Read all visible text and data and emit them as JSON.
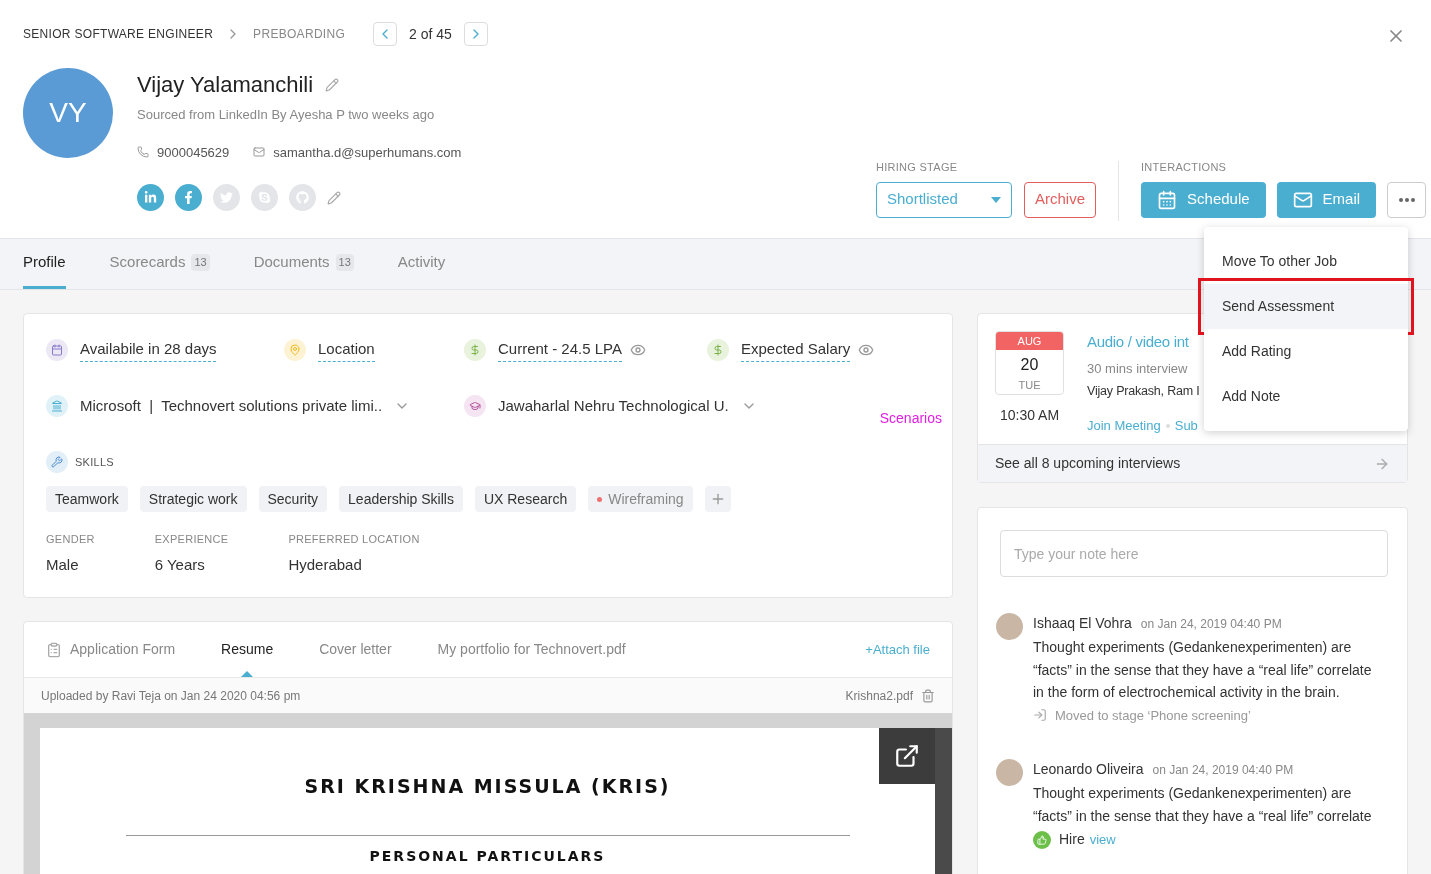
{
  "breadcrumb": {
    "job": "SENIOR SOFTWARE ENGINEER",
    "stage": "PREBOARDING",
    "position": "2 of 45"
  },
  "candidate": {
    "initials": "VY",
    "name": "Vijay Yalamanchili",
    "source": "Sourced from LinkedIn By Ayesha P two weeks ago",
    "phone": "9000045629",
    "email": "samantha.d@superhumans.com",
    "social": [
      {
        "kind": "linkedin",
        "on": true
      },
      {
        "kind": "facebook",
        "on": true
      },
      {
        "kind": "twitter",
        "on": false
      },
      {
        "kind": "skype",
        "on": false
      },
      {
        "kind": "github",
        "on": false
      }
    ]
  },
  "hiring_stage": {
    "label": "HIRING STAGE",
    "value": "Shortlisted",
    "archive": "Archive"
  },
  "interactions": {
    "label": "INTERACTIONS",
    "buttons": [
      {
        "kind": "calendar",
        "label": "Schedule"
      },
      {
        "kind": "mail",
        "label": "Email"
      }
    ]
  },
  "menu": [
    {
      "label": "Move To other Job",
      "selected": false,
      "highlighted": false
    },
    {
      "label": "Send Assessment",
      "selected": true,
      "highlighted": true
    },
    {
      "label": "Add Rating",
      "selected": false,
      "highlighted": false
    },
    {
      "label": "Add Note",
      "selected": false,
      "highlighted": false
    }
  ],
  "tabs": [
    {
      "label": "Profile",
      "selected": true
    },
    {
      "label": "Scorecards",
      "count": "13",
      "selected": false
    },
    {
      "label": "Documents",
      "count": "13",
      "selected": false
    },
    {
      "label": "Activity",
      "selected": false
    }
  ],
  "profile": {
    "facts": [
      {
        "kind": "calendar",
        "text": "Availabile in 28 days",
        "eye": false
      },
      {
        "kind": "location",
        "text": "Location",
        "eye": false
      },
      {
        "kind": "money",
        "text": "Current - 24.5 LPA",
        "eye": true
      },
      {
        "kind": "money",
        "text": "Expected Salary",
        "eye": true
      }
    ],
    "work": "Microsoft  |  Technovert solutions private limi..",
    "education": "Jawaharlal Nehru Technological U.",
    "scenarios": "Scenarios",
    "skills_label": "SKILLS",
    "skills": [
      {
        "label": "Teamwork",
        "flagged": false
      },
      {
        "label": "Strategic work",
        "flagged": false
      },
      {
        "label": "Security",
        "flagged": false
      },
      {
        "label": "Leadership Skills",
        "flagged": false
      },
      {
        "label": "UX Research",
        "flagged": false
      },
      {
        "label": "Wireframing",
        "flagged": true
      }
    ],
    "details": [
      {
        "label": "GENDER",
        "value": "Male"
      },
      {
        "label": "EXPERIENCE",
        "value": "6 Years"
      },
      {
        "label": "PREFERRED LOCATION",
        "value": "Hyderabad"
      }
    ]
  },
  "documents": {
    "tabs": [
      {
        "label": "Application Form",
        "selected": false
      },
      {
        "label": "Resume",
        "selected": true
      },
      {
        "label": "Cover letter",
        "selected": false
      },
      {
        "label": "My portfolio for Technovert.pdf",
        "selected": false
      }
    ],
    "attach": "+Attach file",
    "uploaded": "Uploaded by Ravi Teja on Jan 24 2020 04:56 pm",
    "file": "Krishna2.pdf",
    "resume_title": "SRI KRISHNA MISSULA (KRIS)",
    "resume_section": "PERSONAL PARTICULARS"
  },
  "interview": {
    "month": "AUG",
    "day": "20",
    "weekday": "TUE",
    "time": "10:30 AM",
    "title": "Audio / video int",
    "duration": "30 mins interview",
    "panel": "Vijay Prakash, Ram I",
    "links": [
      "Join Meeting",
      "Sub"
    ],
    "see_all": "See all 8 upcoming interviews"
  },
  "notes": {
    "placeholder": "Type your note here",
    "items": [
      {
        "author": "Ishaaq El Vohra",
        "date": "on Jan 24, 2019 04:40 PM",
        "text": "Thought experiments (Gedankenexperimenten) are “facts” in the sense that they have a “real life” correlate in the form of electrochemical activity in the brain.",
        "kind": "stage",
        "activity": "Moved to stage ‘Phone screening’"
      },
      {
        "author": "Leonardo Oliveira",
        "date": "on Jan 24, 2019 04:40 PM",
        "text": "Thought experiments (Gedankenexperimenten) are “facts” in the sense that they have a “real life” correlate",
        "kind": "hire",
        "activity": "Hire",
        "link": "view"
      }
    ]
  }
}
